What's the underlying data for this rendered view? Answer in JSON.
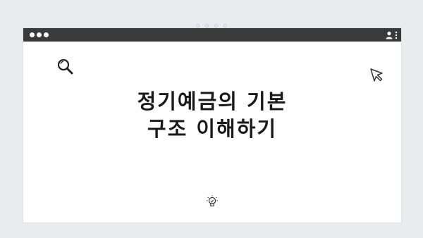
{
  "window": {
    "controls": [
      "close",
      "minimize",
      "maximize"
    ],
    "menu_icons": [
      "user-icon",
      "more-vertical-icon"
    ]
  },
  "content": {
    "headline_line1": "정기예금의 기본",
    "headline_line2": "구조 이해하기",
    "icons": [
      "search-icon",
      "cursor-arrow-icon",
      "lightbulb-icon"
    ]
  },
  "colors": {
    "page_background": "#e9ecef",
    "titlebar": "#3a3a3a",
    "canvas": "#ffffff",
    "text": "#1a1a1a"
  }
}
